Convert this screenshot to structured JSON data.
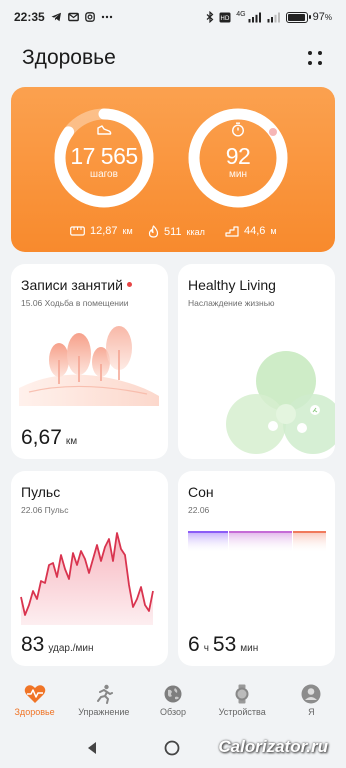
{
  "status_bar": {
    "time": "22:35",
    "battery_text": "97",
    "battery_percent_sign": "%",
    "battery_level": 0.97,
    "network_badge": "4G"
  },
  "header": {
    "title": "Здоровье"
  },
  "activity": {
    "steps_value": "17 565",
    "steps_unit": "шагов",
    "steps_progress": 0.85,
    "minutes_value": "92",
    "minutes_unit": "мин",
    "minutes_progress": 1.0,
    "distance": "12,87",
    "distance_unit": "км",
    "calories": "511",
    "calories_unit": "ккал",
    "floors": "44,6",
    "floors_unit": "м"
  },
  "cards": {
    "workouts": {
      "title": "Записи занятий",
      "subtitle": "15.06 Ходьба в помещении",
      "value": "6,67",
      "unit": "км"
    },
    "healthy_living": {
      "title": "Healthy Living",
      "subtitle": "Наслаждение жизнью"
    },
    "pulse": {
      "title": "Пульс",
      "subtitle": "22.06 Пульс",
      "value": "83",
      "unit": "удар./мин"
    },
    "sleep": {
      "title": "Сон",
      "subtitle": "22.06",
      "hours": "6",
      "hours_unit": "ч",
      "minutes": "53",
      "minutes_unit": "мин"
    }
  },
  "bottom_nav": [
    {
      "label": "Здоровье",
      "icon": "heart-pulse-icon"
    },
    {
      "label": "Упражнение",
      "icon": "running-icon"
    },
    {
      "label": "Обзор",
      "icon": "globe-icon"
    },
    {
      "label": "Устройства",
      "icon": "watch-icon"
    },
    {
      "label": "Я",
      "icon": "profile-icon"
    }
  ],
  "watermark": "Calorizator.ru",
  "colors": {
    "accent": "#f07426",
    "activity_bg": "#f98c31",
    "pulse_line": "#d9344f",
    "sleep_deep": "#8b5cf6",
    "sleep_light": "#c56bd6",
    "sleep_rem": "#f07a5c"
  }
}
